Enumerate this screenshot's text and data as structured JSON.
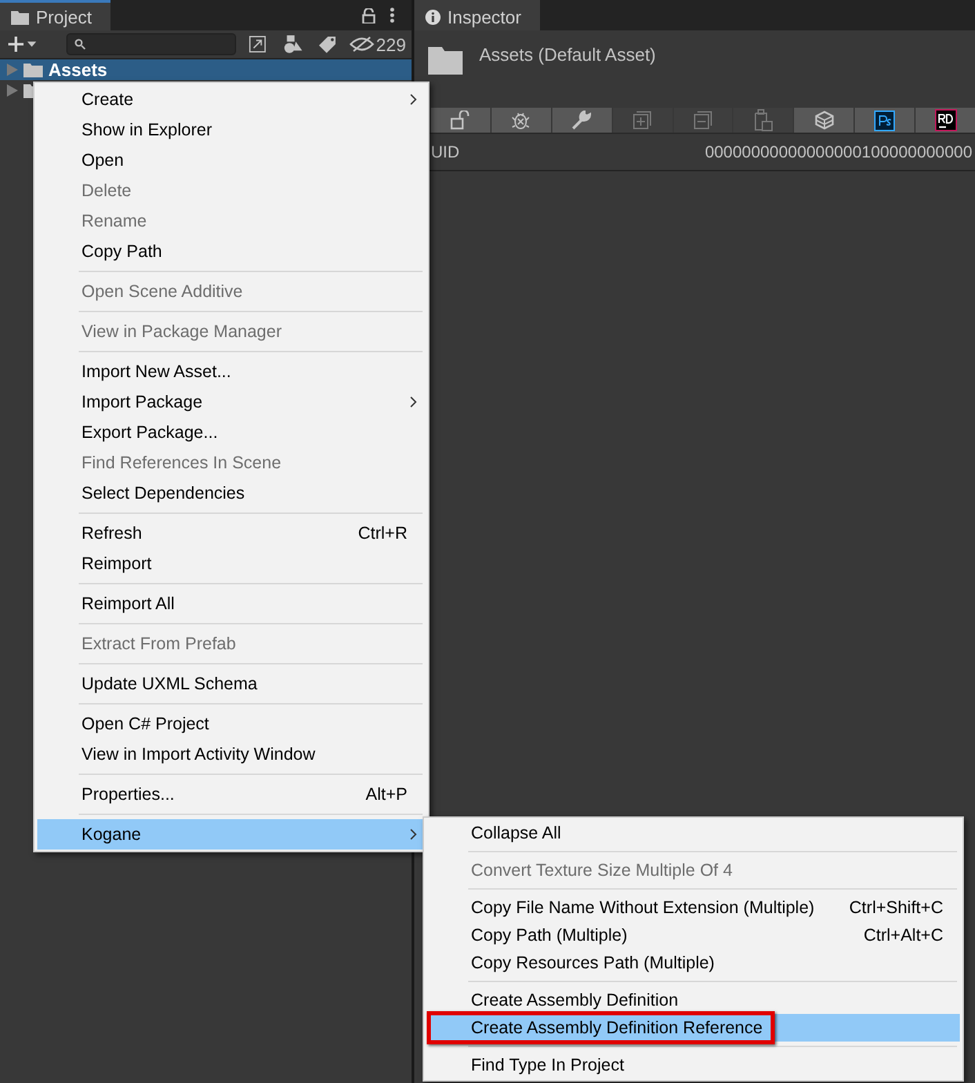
{
  "project": {
    "tab": "Project",
    "hidden_count": "229",
    "tree": [
      {
        "label": "Assets",
        "selected": true
      },
      {
        "selected": false
      }
    ]
  },
  "inspector": {
    "tab": "Inspector",
    "title": "Assets (Default Asset)",
    "toolbar": [
      {
        "kind": "lock",
        "disabled": false
      },
      {
        "kind": "bug",
        "disabled": false
      },
      {
        "kind": "wrench",
        "disabled": false
      },
      {
        "kind": "add",
        "disabled": true
      },
      {
        "kind": "remove",
        "disabled": true
      },
      {
        "kind": "paste",
        "disabled": true
      },
      {
        "kind": "cube",
        "disabled": false
      },
      {
        "kind": "ps",
        "disabled": false
      },
      {
        "kind": "rd",
        "disabled": false
      }
    ],
    "guid_label": "UID",
    "guid_value": "00000000000000000100000000000"
  },
  "context_menu": [
    {
      "kind": "item",
      "label": "Create",
      "disabled": false,
      "has_submenu": true,
      "selected": false
    },
    {
      "kind": "item",
      "label": "Show in Explorer",
      "disabled": false,
      "has_submenu": false,
      "selected": false
    },
    {
      "kind": "item",
      "label": "Open",
      "disabled": false,
      "has_submenu": false,
      "selected": false
    },
    {
      "kind": "item",
      "label": "Delete",
      "disabled": true,
      "has_submenu": false,
      "selected": false
    },
    {
      "kind": "item",
      "label": "Rename",
      "disabled": true,
      "has_submenu": false,
      "selected": false
    },
    {
      "kind": "item",
      "label": "Copy Path",
      "disabled": false,
      "has_submenu": false,
      "selected": false
    },
    {
      "kind": "separator"
    },
    {
      "kind": "item",
      "label": "Open Scene Additive",
      "disabled": true,
      "has_submenu": false,
      "selected": false
    },
    {
      "kind": "separator"
    },
    {
      "kind": "item",
      "label": "View in Package Manager",
      "disabled": true,
      "has_submenu": false,
      "selected": false
    },
    {
      "kind": "separator"
    },
    {
      "kind": "item",
      "label": "Import New Asset...",
      "disabled": false,
      "has_submenu": false,
      "selected": false
    },
    {
      "kind": "item",
      "label": "Import Package",
      "disabled": false,
      "has_submenu": true,
      "selected": false
    },
    {
      "kind": "item",
      "label": "Export Package...",
      "disabled": false,
      "has_submenu": false,
      "selected": false
    },
    {
      "kind": "item",
      "label": "Find References In Scene",
      "disabled": true,
      "has_submenu": false,
      "selected": false
    },
    {
      "kind": "item",
      "label": "Select Dependencies",
      "disabled": false,
      "has_submenu": false,
      "selected": false
    },
    {
      "kind": "separator"
    },
    {
      "kind": "item",
      "label": "Refresh",
      "shortcut": "Ctrl+R",
      "disabled": false,
      "has_submenu": false,
      "selected": false
    },
    {
      "kind": "item",
      "label": "Reimport",
      "disabled": false,
      "has_submenu": false,
      "selected": false
    },
    {
      "kind": "separator"
    },
    {
      "kind": "item",
      "label": "Reimport All",
      "disabled": false,
      "has_submenu": false,
      "selected": false
    },
    {
      "kind": "separator"
    },
    {
      "kind": "item",
      "label": "Extract From Prefab",
      "disabled": true,
      "has_submenu": false,
      "selected": false
    },
    {
      "kind": "separator"
    },
    {
      "kind": "item",
      "label": "Update UXML Schema",
      "disabled": false,
      "has_submenu": false,
      "selected": false
    },
    {
      "kind": "separator"
    },
    {
      "kind": "item",
      "label": "Open C# Project",
      "disabled": false,
      "has_submenu": false,
      "selected": false
    },
    {
      "kind": "item",
      "label": "View in Import Activity Window",
      "disabled": false,
      "has_submenu": false,
      "selected": false
    },
    {
      "kind": "separator"
    },
    {
      "kind": "item",
      "label": "Properties...",
      "shortcut": "Alt+P",
      "disabled": false,
      "has_submenu": false,
      "selected": false
    },
    {
      "kind": "separator"
    },
    {
      "kind": "item",
      "label": "Kogane",
      "disabled": false,
      "has_submenu": true,
      "selected": true
    }
  ],
  "submenu": [
    {
      "kind": "item",
      "label": "Collapse All",
      "disabled": false,
      "selected": false,
      "outlined": false
    },
    {
      "kind": "separator"
    },
    {
      "kind": "item",
      "label": "Convert Texture Size Multiple Of 4",
      "disabled": true,
      "selected": false,
      "outlined": false
    },
    {
      "kind": "separator"
    },
    {
      "kind": "item",
      "label": "Copy File Name Without Extension (Multiple)",
      "shortcut": "Ctrl+Shift+C",
      "disabled": false,
      "selected": false,
      "outlined": false
    },
    {
      "kind": "item",
      "label": "Copy Path (Multiple)",
      "shortcut": "Ctrl+Alt+C",
      "disabled": false,
      "selected": false,
      "outlined": false
    },
    {
      "kind": "item",
      "label": "Copy Resources Path (Multiple)",
      "disabled": false,
      "selected": false,
      "outlined": false
    },
    {
      "kind": "separator"
    },
    {
      "kind": "item",
      "label": "Create Assembly Definition",
      "disabled": false,
      "selected": false,
      "outlined": false
    },
    {
      "kind": "item",
      "label": "Create Assembly Definition Reference",
      "disabled": false,
      "selected": true,
      "outlined": true
    },
    {
      "kind": "separator"
    },
    {
      "kind": "item",
      "label": "Find Type In Project",
      "disabled": false,
      "selected": false,
      "outlined": false
    }
  ]
}
